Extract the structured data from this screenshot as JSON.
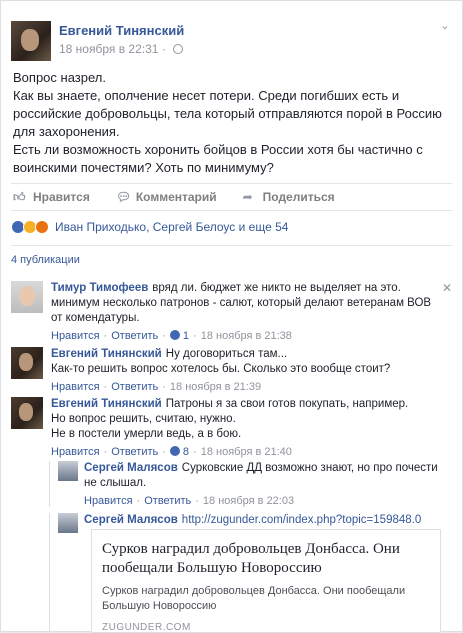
{
  "post": {
    "author": "Евгений Тинянский",
    "date": "18 ноября в 22:31",
    "text_lines": [
      "Вопрос назрел.",
      "Как вы знаете, ополчение несет потери. Среди погибших есть и",
      "российские добровольцы, тела который отправляются порой в Россию",
      "для захоронения.",
      "Есть ли возможность хоронить бойцов в России хотя бы частично с",
      "воинскими почестями? Хоть по минимуму?"
    ]
  },
  "actions": {
    "like": "Нравится",
    "comment": "Комментарий",
    "share": "Поделиться"
  },
  "reactions": {
    "names": "Иван Приходько, Сергей Белоус и еще 54"
  },
  "shares": {
    "label": "4 публикации"
  },
  "comments": [
    {
      "author": "Тимур Тимофеев",
      "text": "вряд ли. бюджет же никто не выделяет на это. минимум несколько патронов - салют, который делают ветеранам ВОВ от комендатуры.",
      "like": "Нравится",
      "reply": "Ответить",
      "likes": "1",
      "time": "18 ноября в 21:38"
    },
    {
      "author": "Евгений Тинянский",
      "text_line1": "Ну договориться там...",
      "text_line2": "Как-то решить вопрос хотелось бы. Сколько это вообще стоит?",
      "like": "Нравится",
      "reply": "Ответить",
      "time": "18 ноября в 21:39"
    },
    {
      "author": "Евгений Тинянский",
      "text_line1": "Патроны я за свои готов покупать, например.",
      "text_line2": "Но вопрос решить, считаю, нужно.",
      "text_line3": "Не в постели умерли ведь, а в бою.",
      "like": "Нравится",
      "reply": "Ответить",
      "likes": "8",
      "time": "18 ноября в 21:40"
    }
  ],
  "replies": [
    {
      "author": "Сергей Малясов",
      "text": "Сурковские ДД возможно знают, но про почести не слышал.",
      "like": "Нравится",
      "reply": "Ответить",
      "time": "18 ноября в 22:03"
    },
    {
      "author": "Сергей Малясов",
      "text": "http://zugunder.com/index.php?topic=159848.0"
    }
  ],
  "link_card": {
    "title": "Сурков наградил добровольцев Донбасса. Они пообещали Большую Новороссию",
    "description": "Сурков наградил добровольцев Донбасса. Они пообещали Большую Новороссию",
    "domain": "ZUGUNDER.COM"
  },
  "icons": {
    "like": "thumbs-up-icon",
    "comment": "comment-icon",
    "share": "share-arrow-icon",
    "globe": "globe-icon",
    "menu": "chevron-down-icon"
  },
  "colors": {
    "link": "#365899",
    "muted": "#90949c",
    "like_blue": "#4267b2"
  }
}
